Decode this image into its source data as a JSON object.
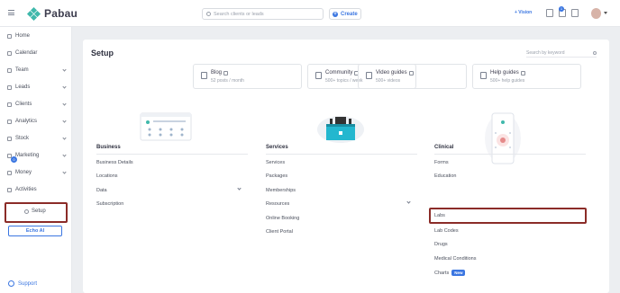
{
  "brand": {
    "name": "Pabau",
    "accent": "#3fb8ab",
    "link_color": "#3b76e1"
  },
  "header": {
    "search_placeholder": "Search clients or leads",
    "create_label": "Create",
    "vision_label": "+ Vision",
    "notification_count": "1"
  },
  "sidebar": {
    "items": [
      {
        "label": "Home"
      },
      {
        "label": "Calendar"
      },
      {
        "label": "Team"
      },
      {
        "label": "Leads"
      },
      {
        "label": "Clients"
      },
      {
        "label": "Analytics"
      },
      {
        "label": "Stock"
      },
      {
        "label": "Marketing"
      },
      {
        "label": "Money"
      },
      {
        "label": "Activities"
      }
    ],
    "activities_badge": "0",
    "setup_label": "Setup",
    "echo_label": "Echo AI",
    "support_label": "Support"
  },
  "main": {
    "title": "Setup",
    "keyword_placeholder": "Search by keyword",
    "tiles": [
      {
        "title": "Blog",
        "sub": "52 posts / month"
      },
      {
        "title": "Community",
        "sub": "500+ topics / week"
      },
      {
        "title": "Video guides",
        "sub": "500+ videos"
      },
      {
        "title": "Help guides",
        "sub": "500+ help guides"
      }
    ],
    "sections": [
      {
        "title": "Business",
        "items": [
          "Business Details",
          "Locations",
          "Data",
          "Subscription"
        ]
      },
      {
        "title": "Services",
        "items": [
          "Services",
          "Packages",
          "Memberships",
          "Resources",
          "Online Booking",
          "Client Portal"
        ]
      },
      {
        "title": "Clinical",
        "items": [
          "Forms",
          "Education",
          "Labs",
          "Lab Codes",
          "Drugs",
          "Medical Conditions",
          "Charts"
        ]
      }
    ],
    "new_badge": "New"
  }
}
